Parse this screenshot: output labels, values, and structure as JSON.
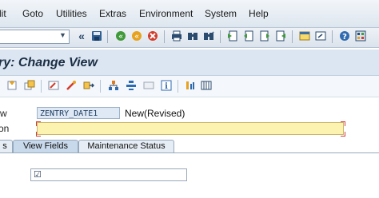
{
  "menubar": {
    "items": [
      "lit",
      "Goto",
      "Utilities",
      "Extras",
      "Environment",
      "System",
      "Help"
    ]
  },
  "toolbar": {
    "icons": [
      "back-icon",
      "save-icon",
      "back-green-icon",
      "exit-icon",
      "cancel-icon",
      "print-icon",
      "find-icon",
      "find-next-icon",
      "first-page-icon",
      "prev-page-icon",
      "next-page-icon",
      "last-page-icon",
      "create-session-icon",
      "shortcut-icon",
      "help-icon",
      "customize-icon"
    ]
  },
  "title": {
    "text": "ry: Change View"
  },
  "app_toolbar": {
    "icons": [
      "new-entries-icon",
      "copy-icon",
      "display-icon",
      "change-icon",
      "transport-icon",
      "hierarchy-icon",
      "hierarchy2-icon",
      "details-icon",
      "info-icon",
      "config-icon",
      "table-icon"
    ]
  },
  "form": {
    "row1_label": "w",
    "key_value": "ZENTRY_DATE1",
    "key_desc": "New(Revised)",
    "row2_label": "on",
    "description_value": ""
  },
  "tabs": [
    {
      "label": "s"
    },
    {
      "label": "View Fields"
    },
    {
      "label": "Maintenance Status"
    }
  ],
  "panel": {
    "checkbox_mark": "☑"
  }
}
